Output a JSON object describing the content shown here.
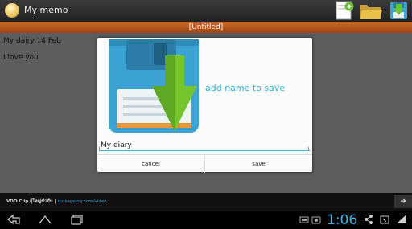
{
  "app": {
    "title": "My memo"
  },
  "document": {
    "name": "[Untitled]"
  },
  "memo": {
    "lines": [
      "My dairy 14 Feb",
      "I love you"
    ]
  },
  "dialog": {
    "message": "add name to save",
    "name_value": "My diary",
    "cancel_label": "cancel",
    "save_label": "save"
  },
  "ad": {
    "text": "VDO Clip ผู้ใหญ่ขำขัน",
    "link": "nutsagelog.com/video"
  },
  "status": {
    "time": "1:06"
  },
  "colors": {
    "accent": "#35b6e8",
    "docbar": "#b8561c",
    "disk": "#3ba3d4",
    "arrow": "#77c52e"
  }
}
